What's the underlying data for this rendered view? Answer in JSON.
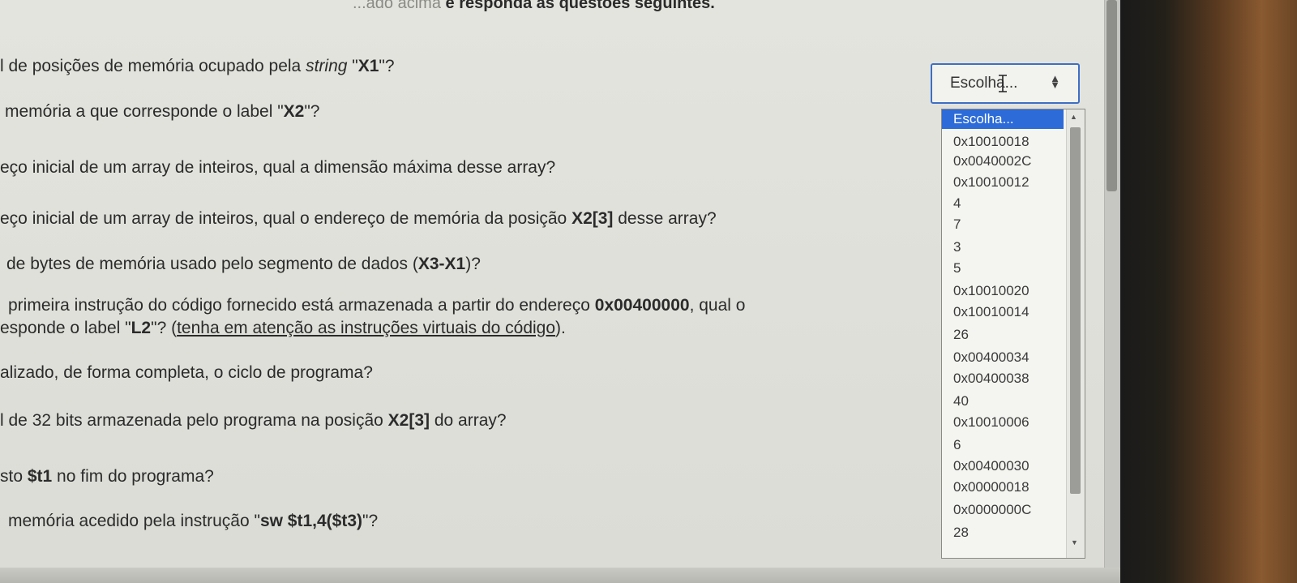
{
  "heading": {
    "faded": "...ado acima",
    "text": "e responda às questões seguintes."
  },
  "questions": [
    {
      "parts": [
        "l de posições de memória ocupado pela ",
        "string",
        " \"",
        "X1",
        "\"?"
      ]
    },
    {
      "parts": [
        "memória a que corresponde o label \"",
        "X2",
        "\"?"
      ]
    },
    {
      "parts": [
        "eço inicial de um array de inteiros, qual a dimensão máxima desse array?"
      ]
    },
    {
      "parts": [
        "eço inicial de um array de inteiros, qual o endereço de memória da posição ",
        "X2[3]",
        " desse array?"
      ]
    },
    {
      "parts": [
        "de bytes de memória usado pelo segmento de dados (",
        "X3-X1",
        ")?"
      ]
    },
    {
      "parts": [
        "primeira instrução do código fornecido está armazenada a partir do endereço ",
        "0x00400000",
        ", qual o"
      ]
    },
    {
      "parts": [
        "esponde o label \"",
        "L2",
        "\"? (",
        "tenha em atenção as instruções virtuais do código",
        ")."
      ]
    },
    {
      "parts": [
        "alizado, de forma completa, o ciclo de programa?"
      ]
    },
    {
      "parts": [
        "l de 32 bits armazenada pelo programa na posição ",
        "X2[3]",
        " do array?"
      ]
    },
    {
      "parts": [
        "sto ",
        "$t1",
        " no fim do programa?"
      ]
    },
    {
      "parts": [
        "memória acedido pela instrução \"",
        "sw $t1,4($t3)",
        "\"?"
      ]
    }
  ],
  "select": {
    "value": "Escolha...",
    "options": [
      "Escolha...",
      "0x10010018",
      "0x0040002C",
      "0x10010012",
      "4",
      "7",
      "3",
      "5",
      "0x10010020",
      "0x10010014",
      "26",
      "0x00400034",
      "0x00400038",
      "40",
      "0x10010006",
      "6",
      "0x00400030",
      "0x00000018",
      "0x0000000C",
      "28"
    ],
    "selected_index": 0
  },
  "colors": {
    "selection": "#2c6bd8",
    "focus_border": "#3d6fc6"
  },
  "icons": {
    "select_arrows": "updown-chevron-icon",
    "cursor": "text-cursor-icon"
  }
}
